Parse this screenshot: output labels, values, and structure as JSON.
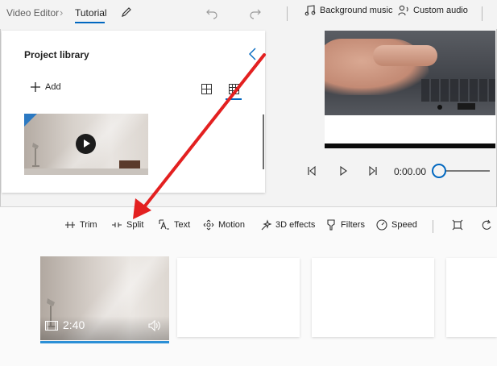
{
  "header": {
    "app_name": "Video Editor",
    "project_name": "Tutorial",
    "background_music_label": "Background music",
    "custom_audio_label": "Custom audio"
  },
  "library": {
    "title": "Project library",
    "add_label": "Add"
  },
  "playback": {
    "time": "0:00.00"
  },
  "toolbar": {
    "trim": "Trim",
    "split": "Split",
    "text": "Text",
    "motion": "Motion",
    "effects_3d": "3D effects",
    "filters": "Filters",
    "speed": "Speed"
  },
  "storyboard": {
    "clip_duration": "2:40"
  },
  "colors": {
    "accent": "#0067c0",
    "annotation_arrow": "#e32020"
  }
}
